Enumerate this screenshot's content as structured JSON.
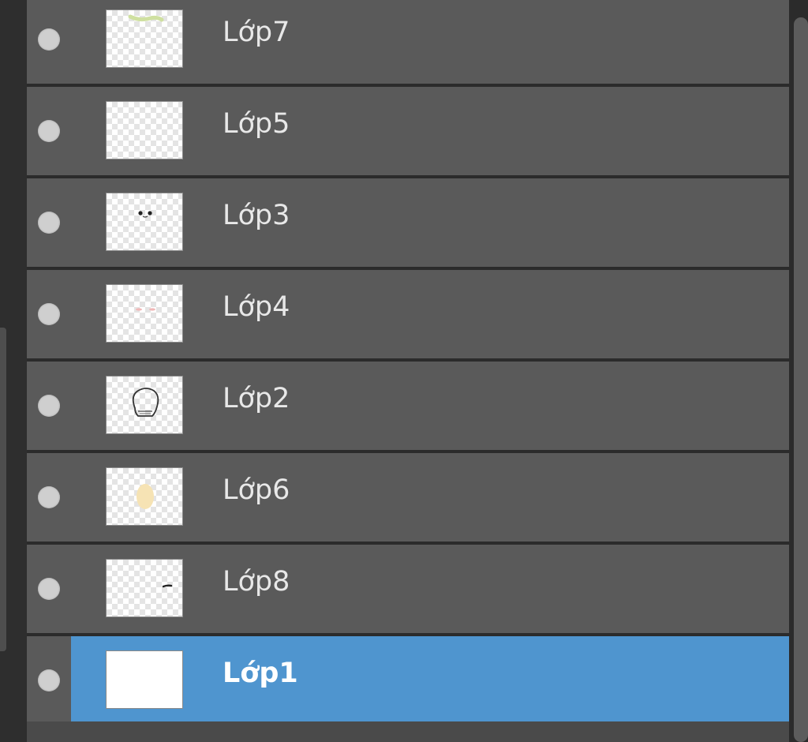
{
  "layers_panel": {
    "layers": [
      {
        "name": "Lớp7",
        "visibility_icon": "eye-dot-icon",
        "thumbnail": "green-mark",
        "selected": false
      },
      {
        "name": "Lớp5",
        "visibility_icon": "eye-dot-icon",
        "thumbnail": "empty",
        "selected": false
      },
      {
        "name": "Lớp3",
        "visibility_icon": "eye-dot-icon",
        "thumbnail": "black-dots",
        "selected": false
      },
      {
        "name": "Lớp4",
        "visibility_icon": "eye-dot-icon",
        "thumbnail": "pink-dots",
        "selected": false
      },
      {
        "name": "Lớp2",
        "visibility_icon": "eye-dot-icon",
        "thumbnail": "face-sketch",
        "selected": false
      },
      {
        "name": "Lớp6",
        "visibility_icon": "eye-dot-icon",
        "thumbnail": "yellow-blob",
        "selected": false
      },
      {
        "name": "Lớp8",
        "visibility_icon": "eye-dot-icon",
        "thumbnail": "dark-stroke",
        "selected": false
      },
      {
        "name": "Lớp1",
        "visibility_icon": "eye-dot-icon",
        "thumbnail": "white-fill",
        "selected": true
      }
    ]
  },
  "colors": {
    "row_background": "#5a5a5a",
    "selected_background": "#4f95cf",
    "panel_background": "#2b2b2b",
    "text": "#e8e8e8"
  }
}
